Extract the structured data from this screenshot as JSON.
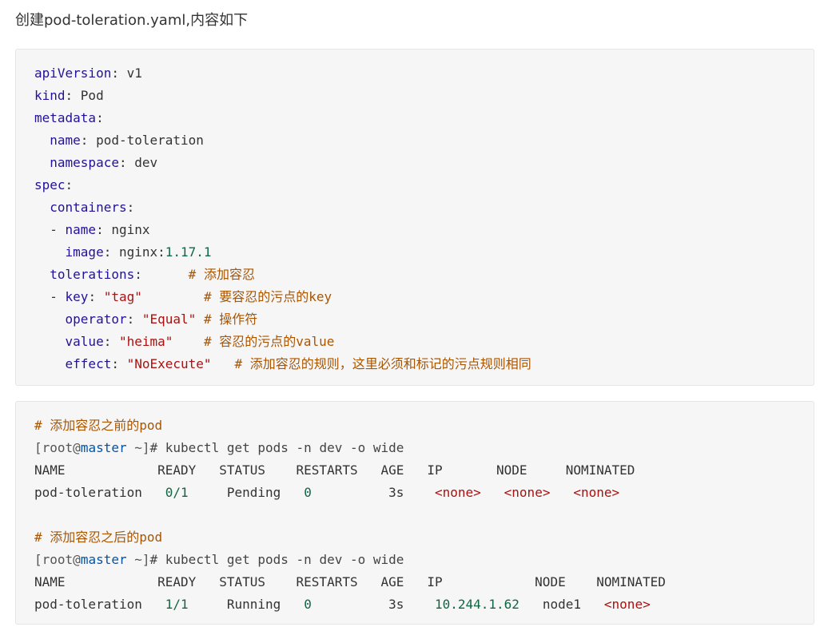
{
  "intro": "创建pod-toleration.yaml,内容如下",
  "yaml": {
    "apiVersion": {
      "key": "apiVersion",
      "value": "v1"
    },
    "kind": {
      "key": "kind",
      "value": "Pod"
    },
    "metadata": {
      "key": "metadata"
    },
    "name": {
      "key": "name",
      "value": "pod-toleration"
    },
    "namespace": {
      "key": "namespace",
      "value": "dev"
    },
    "spec": {
      "key": "spec"
    },
    "containers": {
      "key": "containers"
    },
    "container_name": {
      "key": "name",
      "value": "nginx"
    },
    "image": {
      "key": "image",
      "value_prefix": "nginx:",
      "value_version": "1.17.1"
    },
    "tolerations": {
      "key": "tolerations",
      "comment": "# 添加容忍"
    },
    "tol_key": {
      "key": "key",
      "value": "\"tag\"",
      "comment": "# 要容忍的污点的key"
    },
    "operator": {
      "key": "operator",
      "value": "\"Equal\"",
      "comment": "# 操作符"
    },
    "tol_value": {
      "key": "value",
      "value": "\"heima\"",
      "comment": "# 容忍的污点的value"
    },
    "effect": {
      "key": "effect",
      "value": "\"NoExecute\"",
      "comment": "# 添加容忍的规则，这里必须和标记的污点规则相同"
    }
  },
  "shell": {
    "before": {
      "comment": "# 添加容忍之前的pod",
      "prompt_user": "[root",
      "prompt_at": "@",
      "prompt_host": "master",
      "prompt_rest": " ~]",
      "command": "# kubectl get pods -n dev -o wide",
      "header": [
        "NAME",
        "READY",
        "STATUS",
        "RESTARTS",
        "AGE",
        "IP",
        "NODE",
        "NOMINATED"
      ],
      "row": [
        "pod-toleration",
        "0/1",
        "Pending",
        "0",
        "3s",
        "<none>",
        "<none>",
        "<none>"
      ]
    },
    "after": {
      "comment": "# 添加容忍之后的pod",
      "prompt_user": "[root",
      "prompt_at": "@",
      "prompt_host": "master",
      "prompt_rest": " ~]",
      "command": "# kubectl get pods -n dev -o wide",
      "header": [
        "NAME",
        "READY",
        "STATUS",
        "RESTARTS",
        "AGE",
        "IP",
        "NODE",
        "NOMINATED"
      ],
      "row": [
        "pod-toleration",
        "1/1",
        "Running",
        "0",
        "3s",
        "10.244.1.62",
        "node1",
        "<none>"
      ]
    }
  }
}
